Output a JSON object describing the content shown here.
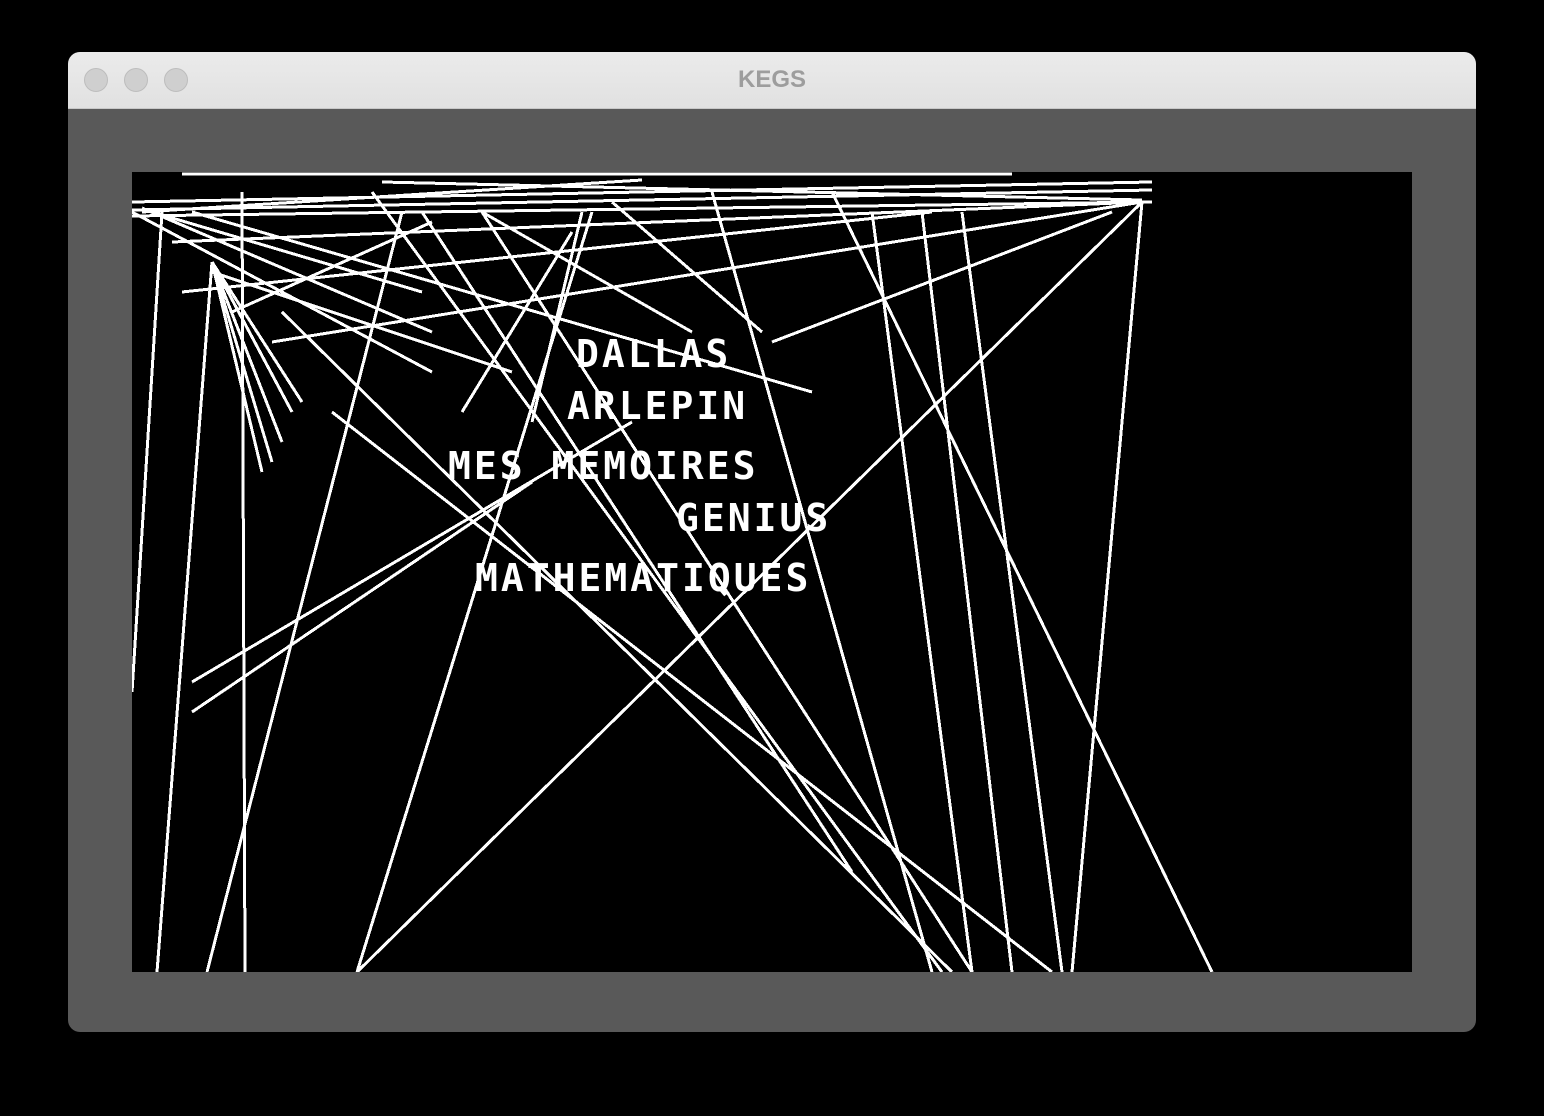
{
  "window": {
    "title": "KEGS"
  },
  "screen": {
    "menu_items": [
      "DALLAS",
      "ARLEPIN",
      "MES MEMOIRES",
      "GENIUS",
      "MATHEMATIQUES"
    ]
  },
  "colors": {
    "background": "#000000",
    "window_frame": "#595959",
    "titlebar": "#e6e6e6",
    "foreground": "#ffffff"
  }
}
